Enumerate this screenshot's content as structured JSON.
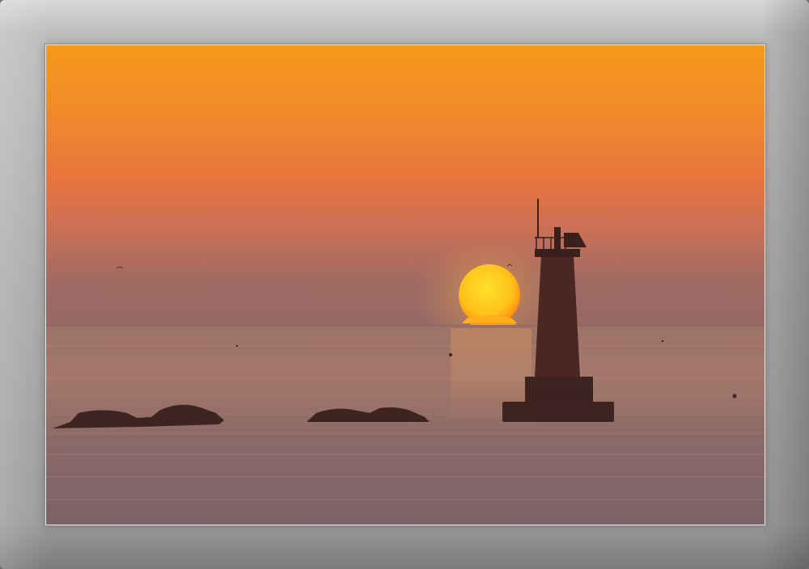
{
  "image": {
    "subject": "sunset-lighthouse-seascape",
    "frame_color": "#a9a9a9",
    "sky_top_color": "#f39a1d",
    "sky_mid_color": "#ee7a35",
    "horizon_haze_color": "#b86f5c",
    "sea_color": "#8f6d69",
    "sun_color": "#ffd21a",
    "silhouette_color": "#3e2420"
  }
}
